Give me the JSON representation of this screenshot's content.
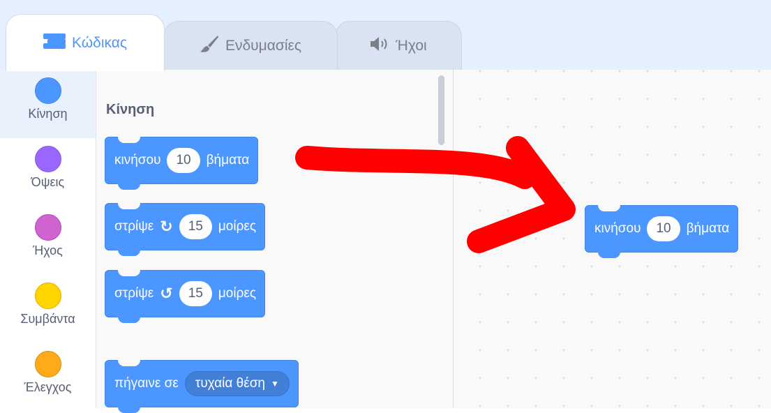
{
  "tabs": [
    {
      "label": "Κώδικας",
      "icon": "code-blocks-icon",
      "active": true
    },
    {
      "label": "Ενδυμασίες",
      "icon": "paintbrush-icon",
      "active": false
    },
    {
      "label": "Ήχοι",
      "icon": "speaker-icon",
      "active": false
    }
  ],
  "categories": [
    {
      "label": "Κίνηση",
      "color": "#4c97ff",
      "selected": true
    },
    {
      "label": "Όψεις",
      "color": "#9966ff",
      "selected": false
    },
    {
      "label": "Ήχος",
      "color": "#cf63cf",
      "selected": false
    },
    {
      "label": "Συμβάντα",
      "color": "#ffd500",
      "selected": false
    },
    {
      "label": "Έλεγχος",
      "color": "#ffab19",
      "selected": false
    }
  ],
  "palette": {
    "title": "Κίνηση",
    "blocks": {
      "move": {
        "text1": "κινήσου",
        "value": "10",
        "text2": "βήματα"
      },
      "turn_right": {
        "text1": "στρίψε",
        "icon": "rotate-clockwise-icon",
        "value": "15",
        "text2": "μοίρες"
      },
      "turn_left": {
        "text1": "στρίψε",
        "icon": "rotate-counterclockwise-icon",
        "value": "15",
        "text2": "μοίρες"
      },
      "goto": {
        "text1": "πήγαινε σε",
        "dropdown": "τυχαία θέση"
      }
    }
  },
  "workspace": {
    "block": {
      "text1": "κινήσου",
      "value": "10",
      "text2": "βήματα"
    },
    "arrow": {
      "color": "#ff0000",
      "icon": "drag-arrow-icon"
    }
  },
  "colors": {
    "motion_block": "#4c97ff",
    "tab_bar": "#e5f0ff",
    "text": "#575e75"
  }
}
